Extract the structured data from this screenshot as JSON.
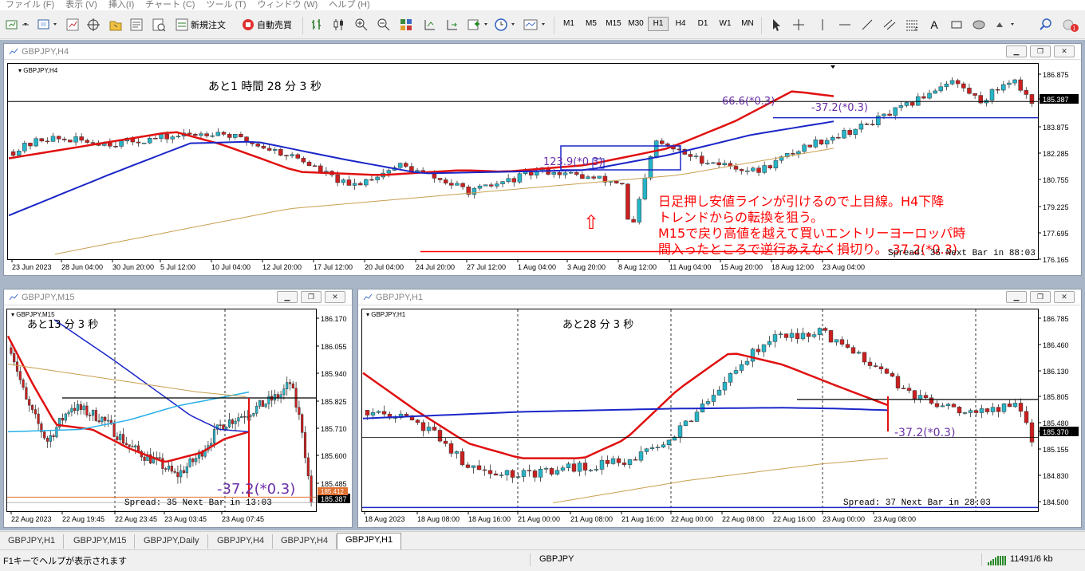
{
  "menu": [
    "ファイル (F)",
    "表示 (V)",
    "挿入(I)",
    "チャート (C)",
    "ツール (T)",
    "ウィンドウ (W)",
    "ヘルプ (H)"
  ],
  "toolbar": {
    "new_order": "新規注文",
    "auto_trade": "自動売買",
    "timeframes": [
      "M1",
      "M5",
      "M15",
      "M30",
      "H1",
      "H4",
      "D1",
      "W1",
      "MN"
    ],
    "active_timeframe": "H1"
  },
  "colors": {
    "bull": "#26b5c8",
    "bear": "#cc1f1f",
    "ema_fast": "#e01010",
    "ma_mid": "#1a26c8",
    "ma_slow": "#c8a050",
    "annotation": "#ff0000",
    "label": "#6a2fa8"
  },
  "windows": {
    "h4": {
      "title": "GBPJPY,H4",
      "symbol_label": "GBPJPY,H4",
      "countdown": "あと1 時間 28 分 3 秒",
      "price_axis": [
        "186.875",
        "185.387",
        "183.875",
        "182.285",
        "180.755",
        "179.225",
        "177.695",
        "176.165"
      ],
      "current_price": "185.387",
      "time_axis": [
        "23 Jun 2023",
        "28 Jun 04:00",
        "30 Jun 20:00",
        "5 Jul 12:00",
        "10 Jul 04:00",
        "12 Jul 20:00",
        "17 Jul 12:00",
        "20 Jul 04:00",
        "24 Jul 20:00",
        "27 Jul 12:00",
        "1 Aug 04:00",
        "3 Aug 20:00",
        "8 Aug 12:00",
        "11 Aug 04:00",
        "15 Aug 20:00",
        "18 Aug 12:00",
        "23 Aug 04:00"
      ],
      "spread_text": "Spread: 35  Next Bar in 88:03",
      "label_left": "123.9(*0.3)",
      "label_top": "66.6(*0.3)",
      "label_right": "-37.2(*0.3)",
      "arrow_symbol": "⇧",
      "commentary": [
        "日足押し安値ラインが引けるので上目線。H4下降",
        "トレンドからの転換を狙う。",
        "M15で戻り高値を越えて買いエントリーヨーロッパ時",
        "間入ったところで逆行あえなく損切り。-37.2(*0.3)"
      ]
    },
    "m15": {
      "title": "GBPJPY,M15",
      "symbol_label": "GBPJPY,M15",
      "countdown": "あと13 分 3 秒",
      "price_axis": [
        "186.170",
        "186.055",
        "185.940",
        "185.825",
        "185.710",
        "185.600",
        "185.485"
      ],
      "current_price": "185.387",
      "red_price": "185.412",
      "time_axis": [
        "22 Aug 2023",
        "22 Aug 19:45",
        "22 Aug 23:45",
        "23 Aug 03:45",
        "23 Aug 07:45"
      ],
      "spread_text": "Spread: 35  Next Bar in 13:03",
      "label": "-37.2(*0.3)"
    },
    "h1": {
      "title": "GBPJPY,H1",
      "symbol_label": "GBPJPY,H1",
      "countdown": "あと28 分 3 秒",
      "price_axis": [
        "186.785",
        "186.460",
        "186.130",
        "185.805",
        "185.480",
        "185.370",
        "185.155",
        "184.830",
        "184.500"
      ],
      "current_price": "185.370",
      "time_axis": [
        "18 Aug 2023",
        "18 Aug 08:00",
        "18 Aug 16:00",
        "21 Aug 00:00",
        "21 Aug 08:00",
        "21 Aug 16:00",
        "22 Aug 00:00",
        "22 Aug 08:00",
        "22 Aug 16:00",
        "23 Aug 00:00",
        "23 Aug 08:00"
      ],
      "spread_text": "Spread: 37  Next Bar in 28:03",
      "label": "-37.2(*0.3)"
    }
  },
  "tabs": [
    "GBPJPY,H1",
    "GBPJPY,M15",
    "GBPJPY,Daily",
    "GBPJPY,H4",
    "GBPJPY,H4",
    "GBPJPY,H1"
  ],
  "active_tab_index": 5,
  "status": {
    "help": "F1キーでヘルプが表示されます",
    "symbol": "GBPJPY",
    "traffic": "11491/6 kb"
  }
}
